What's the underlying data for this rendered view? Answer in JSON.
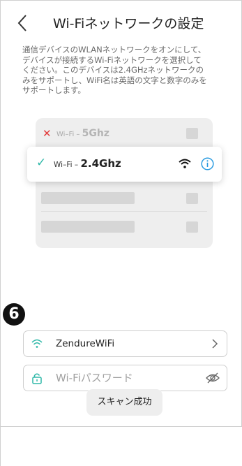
{
  "header": {
    "title": "Wi-Fiネットワークの設定"
  },
  "description": "通信デバイスのWLANネットワークをオンにして、\nデバイスが接続するWi-Fiネットワークを選択して\nください。このデバイスは2.4GHzネットワークの\nみをサポートし、WiFi名は英語の文字と数字のみを\nサポートします。",
  "illustration": {
    "band_5g_prefix": "Wi–Fi – ",
    "band_5g_label": "5Ghz",
    "band_24_prefix": "Wi–Fi – ",
    "band_24_label": "2.4Ghz"
  },
  "step_number": "6",
  "ssid_field": {
    "value": "ZendureWiFi"
  },
  "password_field": {
    "placeholder": "Wi-Fiパスワード"
  },
  "toast": {
    "text": "スキャン成功"
  },
  "icons": {
    "back": "chevron-left-icon",
    "wifi": "wifi-icon",
    "info": "info-icon",
    "lock": "lock-icon",
    "chevron": "chevron-right-icon",
    "eye_off": "eye-off-icon",
    "check": "check-icon",
    "cross": "cross-icon"
  },
  "colors": {
    "accent": "#2fb8a8",
    "info_blue": "#2a9be0",
    "error_red": "#e23c3c"
  }
}
